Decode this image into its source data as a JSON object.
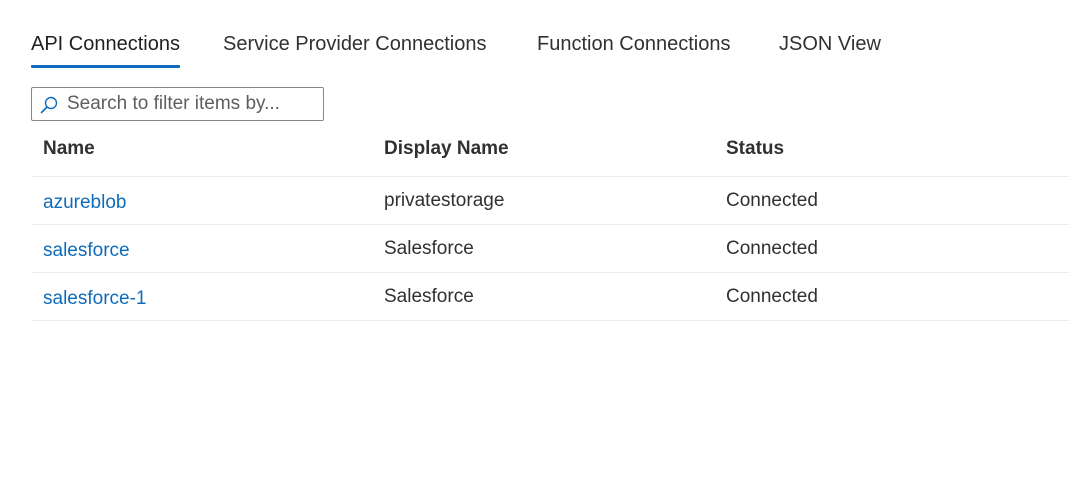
{
  "tabs": [
    {
      "label": "API Connections",
      "active": true
    },
    {
      "label": "Service Provider Connections",
      "active": false
    },
    {
      "label": "Function Connections",
      "active": false
    },
    {
      "label": "JSON View",
      "active": false
    }
  ],
  "search": {
    "placeholder": "Search to filter items by...",
    "value": "",
    "icon": "search-icon"
  },
  "table": {
    "columns": [
      "Name",
      "Display Name",
      "Status"
    ],
    "rows": [
      {
        "name": "azureblob",
        "display_name": "privatestorage",
        "status": "Connected"
      },
      {
        "name": "salesforce",
        "display_name": "Salesforce",
        "status": "Connected"
      },
      {
        "name": "salesforce-1",
        "display_name": "Salesforce",
        "status": "Connected"
      }
    ]
  },
  "colors": {
    "accent": "#0f6cbd",
    "text": "#323130",
    "divider": "#edebe9"
  }
}
